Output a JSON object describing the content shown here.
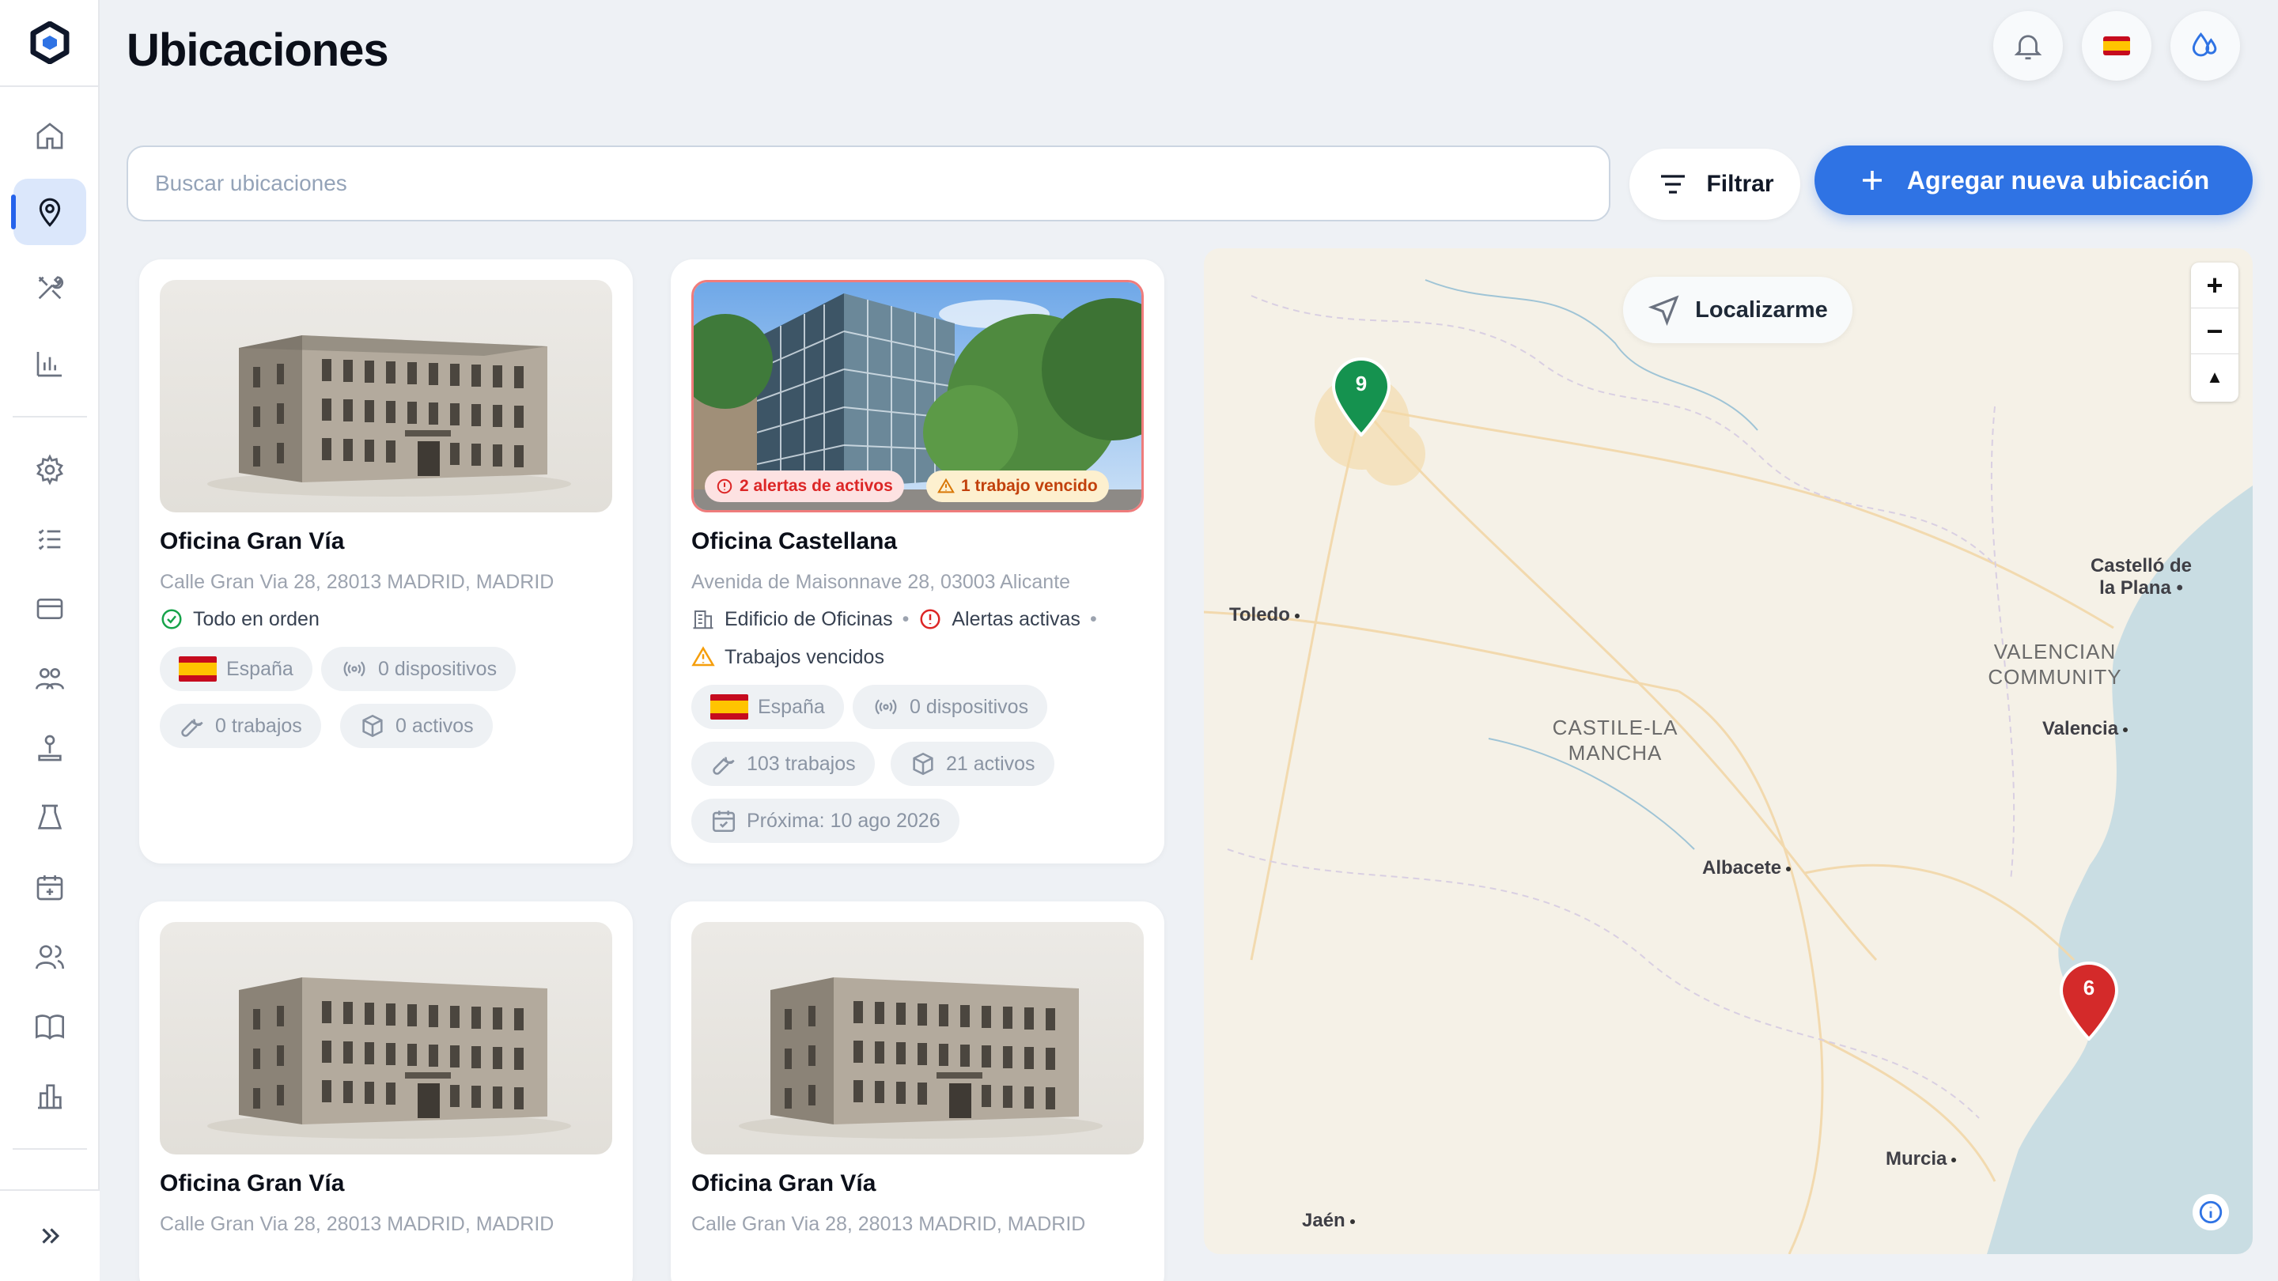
{
  "page": {
    "title": "Ubicaciones"
  },
  "header": {
    "notifications_icon": "bell-icon",
    "language_flag": "🇪🇸",
    "theme_icon": "drops-icon"
  },
  "sidebar": {
    "items": [
      {
        "name": "home-icon",
        "active": false
      },
      {
        "name": "location-pin-icon",
        "active": true
      },
      {
        "name": "tools-icon",
        "active": false
      },
      {
        "name": "chart-icon",
        "active": false
      },
      {
        "name": "settings-icon",
        "active": false
      },
      {
        "name": "checklist-icon",
        "active": false
      },
      {
        "name": "card-icon",
        "active": false
      },
      {
        "name": "team-icon",
        "active": false
      },
      {
        "name": "joystick-icon",
        "active": false
      },
      {
        "name": "lab-icon",
        "active": false
      },
      {
        "name": "calendar-icon",
        "active": false
      },
      {
        "name": "users-icon",
        "active": false
      },
      {
        "name": "book-icon",
        "active": false
      },
      {
        "name": "buildings-icon",
        "active": false
      }
    ],
    "expand_icon": "double-chevron-right-icon"
  },
  "toolbar": {
    "search_placeholder": "Buscar ubicaciones",
    "search_value": "",
    "filter_label": "Filtrar",
    "add_label": "Agregar nueva ubicación"
  },
  "cards": [
    {
      "title": "Oficina Gran Vía",
      "address": "Calle Gran Via 28, 28013 MADRID, MADRID",
      "status": "Todo en orden",
      "country": "España",
      "devices": "0 dispositivos",
      "jobs": "0 trabajos",
      "assets": "0 activos"
    },
    {
      "title": "Oficina Castellana",
      "address": "Avenida de Maisonnave 28, 03003 Alicante",
      "badge_alerts": "2 alertas de activos",
      "badge_overdue": "1 trabajo vencido",
      "type": "Edificio de Oficinas",
      "alerts": "Alertas activas",
      "overdue": "Trabajos vencidos",
      "country": "España",
      "devices": "0 dispositivos",
      "jobs": "103 trabajos",
      "assets": "21 activos",
      "next": "Próxima: 10 ago 2026"
    },
    {
      "title": "Oficina Gran Vía",
      "address": "Calle Gran Via 28, 28013 MADRID, MADRID"
    },
    {
      "title": "Oficina Gran Vía",
      "address": "Calle Gran Via 28, 28013 MADRID, MADRID"
    }
  ],
  "map": {
    "locate_label": "Localizarme",
    "zoom_in": "+",
    "zoom_out": "−",
    "compass": "▲",
    "pins": [
      {
        "count": "9",
        "color": "#15924f"
      },
      {
        "count": "6",
        "color": "#d42a2a"
      }
    ],
    "cities": [
      "Toledo",
      "Castelló de la Plana",
      "Valencia",
      "Albacete",
      "Murcia",
      "Jaén"
    ],
    "regions": [
      "VALENCIAN COMMUNITY",
      "CASTILE-LA MANCHA"
    ]
  },
  "colors": {
    "accent": "#2f73e4",
    "ok": "#16a34a",
    "alert": "#dc2626",
    "warn": "#f59e0b"
  }
}
